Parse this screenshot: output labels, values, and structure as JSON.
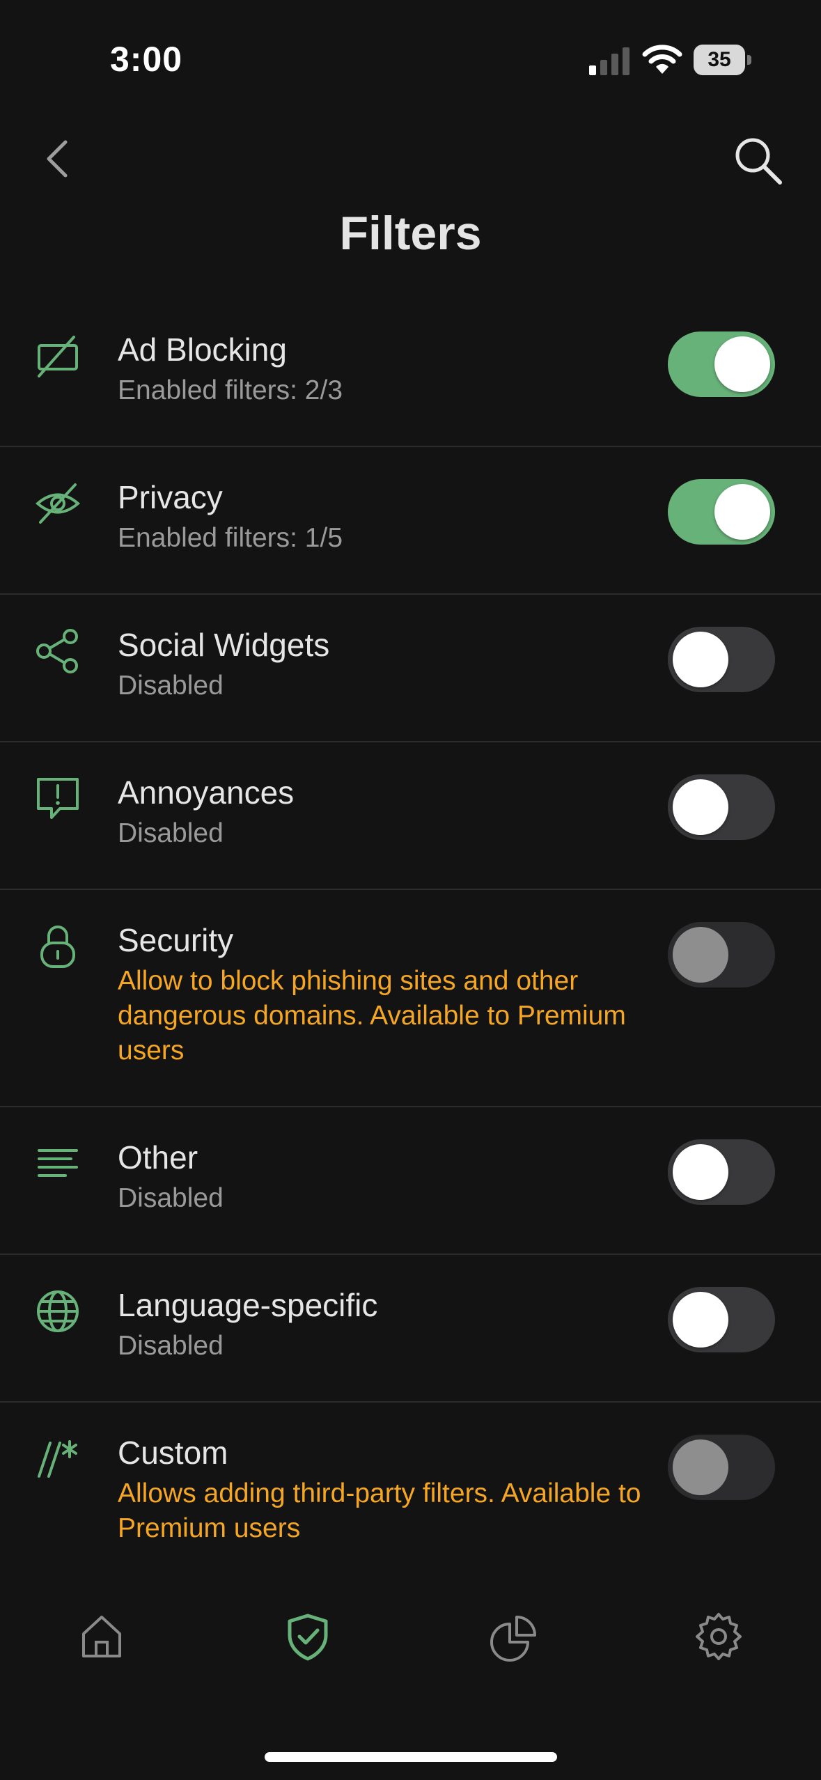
{
  "status_bar": {
    "time": "3:00",
    "battery": "35",
    "icons": [
      "signal-icon",
      "wifi-icon",
      "battery-icon"
    ]
  },
  "header": {
    "title": "Filters",
    "back_icon": "chevron-left-icon",
    "search_icon": "search-icon"
  },
  "filters": [
    {
      "title": "Ad Blocking",
      "subtitle": "Enabled filters: 2/3",
      "icon": "ad-block-icon",
      "state": "on"
    },
    {
      "title": "Privacy",
      "subtitle": "Enabled filters: 1/5",
      "icon": "eye-off-icon",
      "state": "on"
    },
    {
      "title": "Social Widgets",
      "subtitle": "Disabled",
      "icon": "share-nodes-icon",
      "state": "off"
    },
    {
      "title": "Annoyances",
      "subtitle": "Disabled",
      "icon": "alert-message-icon",
      "state": "off"
    },
    {
      "title": "Security",
      "subtitle": "Allow to block phishing sites and other dangerous domains. Available to Premium users",
      "icon": "lock-icon",
      "state": "locked"
    },
    {
      "title": "Other",
      "subtitle": "Disabled",
      "icon": "lines-icon",
      "state": "off"
    },
    {
      "title": "Language-specific",
      "subtitle": "Disabled",
      "icon": "globe-icon",
      "state": "off"
    },
    {
      "title": "Custom",
      "subtitle": "Allows adding third-party filters. Available to Premium users",
      "icon": "custom-rule-icon",
      "state": "locked"
    }
  ],
  "tab_bar": {
    "items": [
      "home-icon",
      "shield-check-icon",
      "pie-chart-icon",
      "gear-icon"
    ],
    "active": "shield-check-icon"
  },
  "colors": {
    "background": "#131313",
    "accent_green": "#67b279",
    "premium_orange": "#f5a623",
    "secondary_text": "#9a9a9a",
    "divider": "#2c2c2c"
  }
}
